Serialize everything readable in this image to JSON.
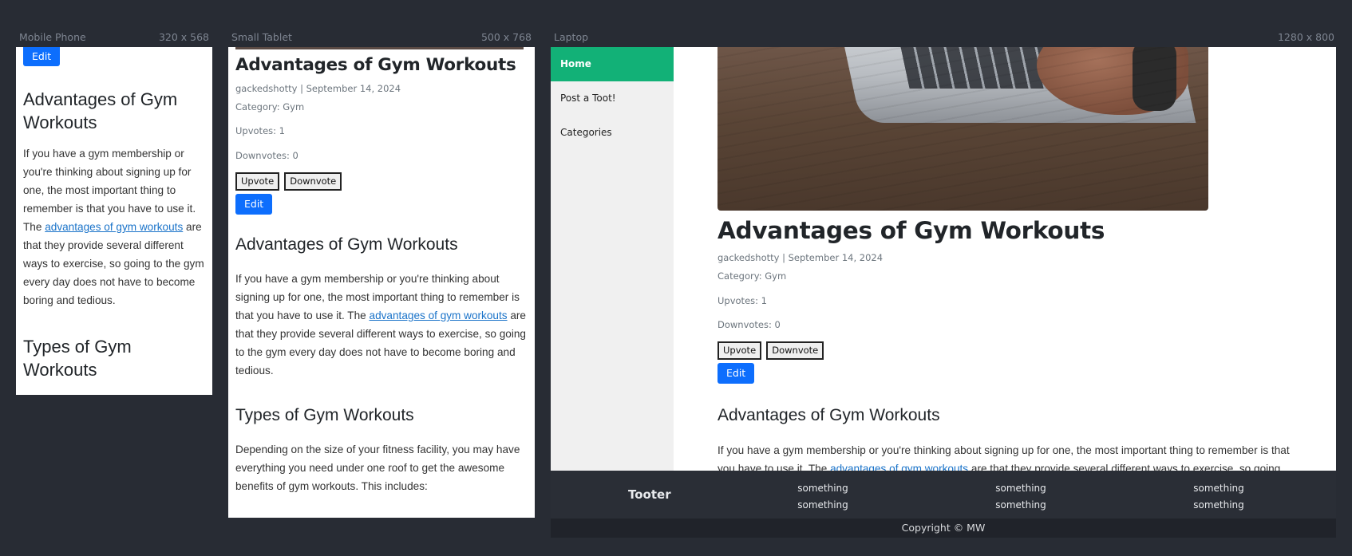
{
  "frames": {
    "mobile": {
      "name": "Mobile Phone",
      "size": "320 x 568"
    },
    "tablet": {
      "name": "Small Tablet",
      "size": "500 x 768"
    },
    "laptop": {
      "name": "Laptop",
      "size": "1280 x 800"
    }
  },
  "post": {
    "title": "Advantages of Gym Workouts",
    "byline": "gackedshotty | September 14, 2024",
    "category": "Category: Gym",
    "upvotes": "Upvotes: 1",
    "downvotes": "Downvotes: 0",
    "upvote_label": "Upvote",
    "downvote_label": "Downvote",
    "edit_label": "Edit"
  },
  "content": {
    "section1_heading": "Advantages of Gym Workouts",
    "section1_before_link": "If you have a gym membership or you're thinking about signing up for one, the most important thing to remember is that you have to use it. The ",
    "section1_link": "advantages of gym workouts",
    "section1_after_link": " are that they provide several different ways to exercise, so going to the gym every day does not have to become boring and tedious.",
    "section2_heading": "Types of Gym Workouts",
    "section2_para": "Depending on the size of your fitness facility, you may have everything you need under one roof to get the awesome benefits of gym workouts. This includes:"
  },
  "sidebar": {
    "items": [
      {
        "label": "Home",
        "active": true
      },
      {
        "label": "Post a Toot!",
        "active": false
      },
      {
        "label": "Categories",
        "active": false
      }
    ]
  },
  "footer": {
    "brand": "Tooter",
    "columns": [
      [
        "something",
        "something"
      ],
      [
        "something",
        "something"
      ],
      [
        "something",
        "something"
      ]
    ],
    "copyright": "Copyright © MW"
  },
  "colors": {
    "background": "#282c34",
    "primary": "#0d6efd",
    "nav_active": "#12b177",
    "footer": "#2a2e36"
  }
}
